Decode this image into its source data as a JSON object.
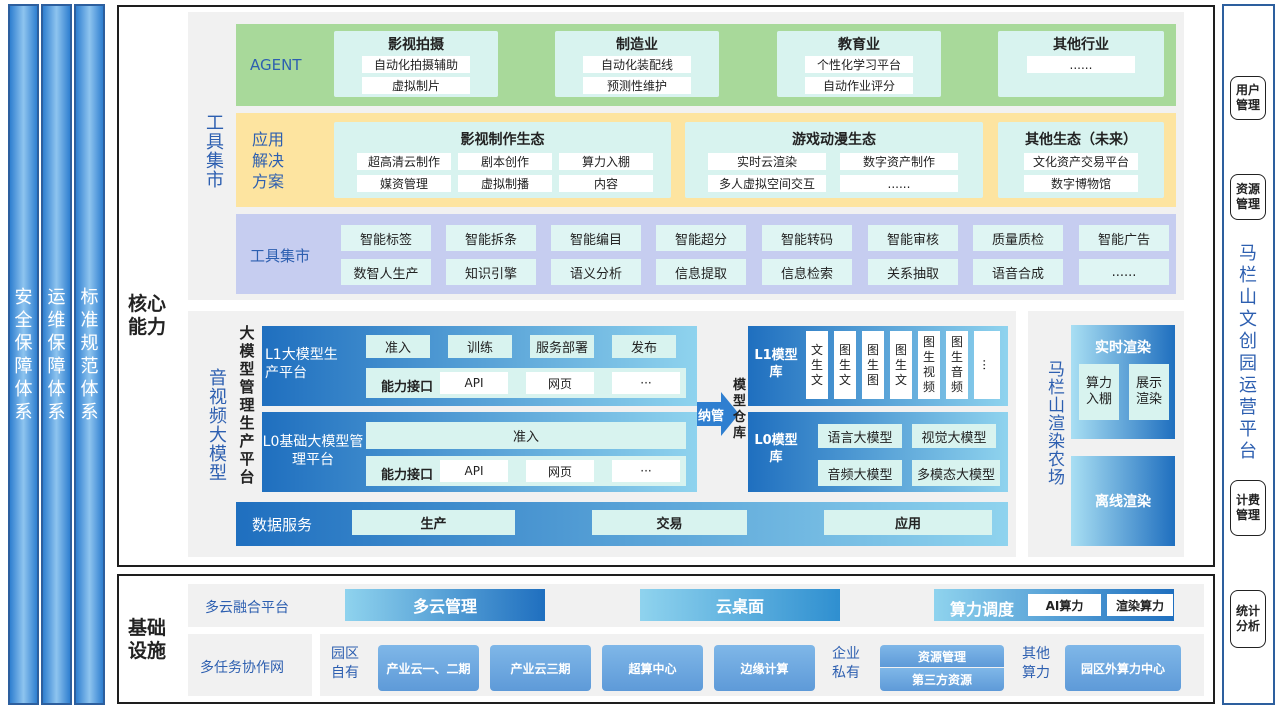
{
  "side_bars": [
    "安全保障体系",
    "运维保障体系",
    "标准规范体系"
  ],
  "core_label": "核心能力",
  "infra_label": "基础设施",
  "tools_market": {
    "side_label": "工具集市",
    "agent": {
      "label": "AGENT",
      "groups": [
        {
          "title": "影视拍摄",
          "items": [
            "自动化拍摄辅助",
            "虚拟制片"
          ]
        },
        {
          "title": "制造业",
          "items": [
            "自动化装配线",
            "预测性维护"
          ]
        },
        {
          "title": "教育业",
          "items": [
            "个性化学习平台",
            "自动作业评分"
          ]
        },
        {
          "title": "其他行业",
          "items": [
            "......"
          ]
        }
      ]
    },
    "solutions": {
      "label": "应用解决方案",
      "groups": [
        {
          "title": "影视制作生态",
          "items": [
            "超高清云制作",
            "剧本创作",
            "算力入棚",
            "媒资管理",
            "虚拟制播",
            "内容"
          ]
        },
        {
          "title": "游戏动漫生态",
          "items": [
            "实时云渲染",
            "数字资产制作",
            "多人虚拟空间交互",
            "......"
          ]
        },
        {
          "title": "其他生态（未来）",
          "items": [
            "文化资产交易平台",
            "数字博物馆"
          ]
        }
      ]
    },
    "tools": {
      "label": "工具集市",
      "items": [
        "智能标签",
        "智能拆条",
        "智能编目",
        "智能超分",
        "智能转码",
        "智能审核",
        "质量质检",
        "智能广告",
        "数智人生产",
        "知识引擎",
        "语义分析",
        "信息提取",
        "信息检索",
        "关系抽取",
        "语音合成",
        "......"
      ]
    }
  },
  "av_model": {
    "side_label": "音视频大模型",
    "mgmt_label": "大模型管理生产平台",
    "l1": {
      "title": "L1大模型生产平台",
      "steps": [
        "准入",
        "训练",
        "服务部署",
        "发布"
      ],
      "api_label": "能力接口",
      "apis": [
        "API",
        "网页",
        "···"
      ]
    },
    "l0": {
      "title": "L0基础大模型管理平台",
      "access": "准入",
      "api_label": "能力接口",
      "apis": [
        "API",
        "网页",
        "···"
      ]
    },
    "nano": "纳管",
    "warehouse": "模型仓库",
    "l1_lib": {
      "title": "L1模型库",
      "items": [
        "文生文",
        "图生文",
        "图生图",
        "图生文",
        "图生视频",
        "图生音频",
        "..."
      ]
    },
    "l0_lib": {
      "title": "L0模型库",
      "items": [
        "语言大模型",
        "视觉大模型",
        "音频大模型",
        "多模态大模型"
      ]
    },
    "data_service": {
      "label": "数据服务",
      "items": [
        "生产",
        "交易",
        "应用"
      ]
    }
  },
  "render_farm": {
    "title": "马栏山渲染农场",
    "realtime": "实时渲染",
    "realtime_items": [
      "算力入棚",
      "展示渲染"
    ],
    "offline": "离线渲染"
  },
  "infra": {
    "multi_cloud": {
      "label": "多云融合平台",
      "mgmt": "多云管理",
      "desktop": "云桌面",
      "compute": "算力调度",
      "compute_items": [
        "AI算力",
        "渲染算力"
      ]
    },
    "network": {
      "label": "多任务协作网",
      "park_label": "园区自有",
      "park_items": [
        "产业云一、二期",
        "产业云三期",
        "超算中心",
        "边缘计算"
      ],
      "enterprise_label": "企业私有",
      "enterprise_items": [
        "资源管理",
        "第三方资源"
      ],
      "other_label": "其他算力",
      "other_items": [
        "园区外算力中心"
      ]
    }
  },
  "right_title": "马栏山文创园运营平台",
  "right_items": [
    "用户管理",
    "资源管理",
    "计费管理",
    "统计分析"
  ]
}
